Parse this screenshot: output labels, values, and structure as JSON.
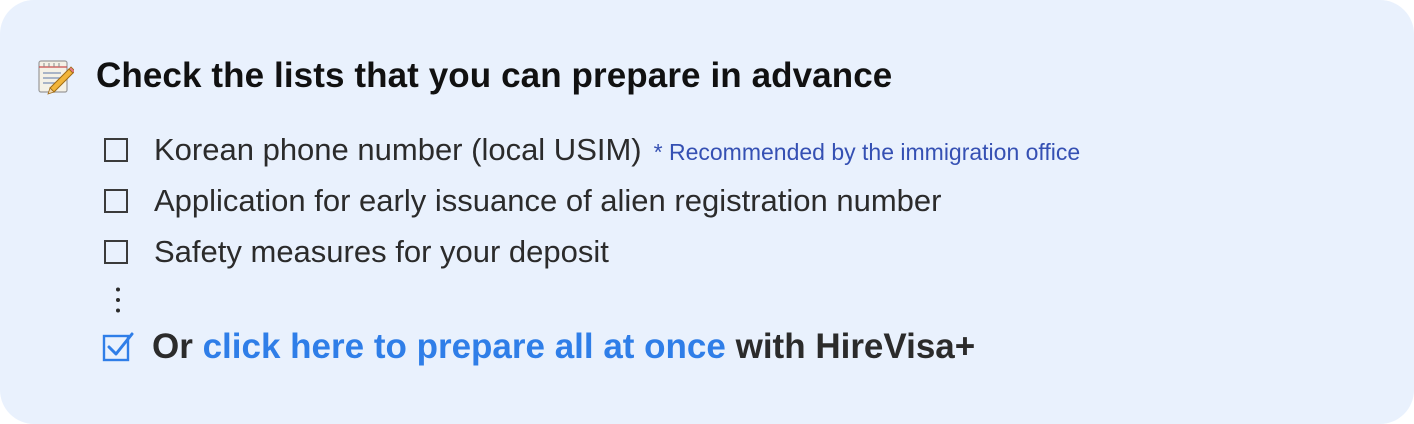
{
  "header": {
    "icon": "memo-icon",
    "title": "Check the lists that you can prepare in advance"
  },
  "checklist": {
    "items": [
      {
        "label": "Korean phone number (local USIM)",
        "note": "* Recommended by the immigration office",
        "checked": false
      },
      {
        "label": "Application for early issuance of alien registration number",
        "checked": false
      },
      {
        "label": "Safety measures for your deposit",
        "checked": false
      }
    ],
    "more_icon": "vertical-ellipsis-icon"
  },
  "cta": {
    "prefix": "Or",
    "link_text": "click here to prepare all at once",
    "suffix": "with HireVisa+",
    "checked": true
  },
  "colors": {
    "background": "#e9f1fd",
    "link": "#2f7ee8",
    "note": "#3550b3",
    "text": "#2b2b2b"
  }
}
